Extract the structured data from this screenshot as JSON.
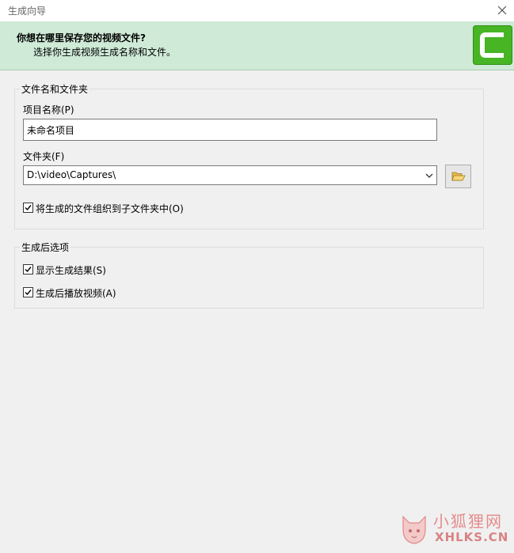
{
  "window": {
    "title": "生成向导"
  },
  "header": {
    "question": "你想在哪里保存您的视频文件?",
    "subtitle": "选择你生成视频生成名称和文件。",
    "logo_icon": "camtasia-logo-icon",
    "accent": "#47b524"
  },
  "group_files": {
    "legend": "文件名和文件夹",
    "project_label": "项目名称(P)",
    "project_value": "未命名项目",
    "folder_label": "文件夹(F)",
    "folder_value": "D:\\video\\Captures\\",
    "organize_label": "将生成的文件组织到子文件夹中(O)",
    "organize_checked": true
  },
  "group_options": {
    "legend": "生成后选项",
    "show_results_label": "显示生成结果(S)",
    "show_results_checked": true,
    "play_video_label": "生成后播放视频(A)",
    "play_video_checked": true
  },
  "watermark": {
    "text_cn": "小狐狸网",
    "text_en": "XHLKS.CN"
  }
}
